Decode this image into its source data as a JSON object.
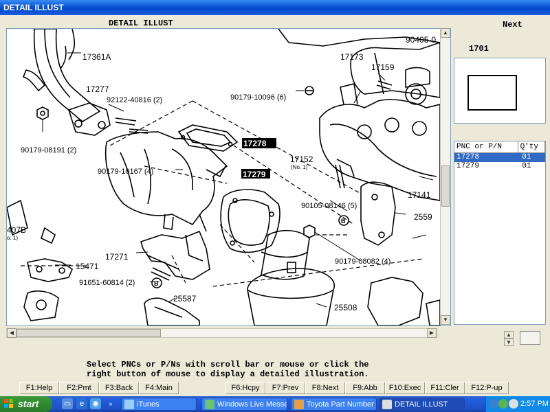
{
  "window": {
    "title": "DETAIL ILLUST"
  },
  "panel": {
    "caption": "DETAIL ILLUST",
    "next_label": "Next",
    "page_number": "1701"
  },
  "illustration": {
    "labels": [
      {
        "text": "90405-0",
        "boxed": false
      },
      {
        "text": "17361A",
        "boxed": false
      },
      {
        "text": "17173",
        "boxed": false
      },
      {
        "text": "17159",
        "boxed": false
      },
      {
        "text": "17277",
        "boxed": false
      },
      {
        "text": "92122-40816 (2)",
        "boxed": false
      },
      {
        "text": "90179-10096 (6)",
        "boxed": false
      },
      {
        "text": "90179-08191 (2)",
        "boxed": false
      },
      {
        "text": "17278",
        "boxed": true
      },
      {
        "text": "17152",
        "boxed": false
      },
      {
        "text": "(No. 1)",
        "boxed": false
      },
      {
        "text": "90179-10167 (4)",
        "boxed": false
      },
      {
        "text": "17279",
        "boxed": true
      },
      {
        "text": "17141",
        "boxed": false
      },
      {
        "text": "90105-08146 (5)",
        "boxed": false
      },
      {
        "text": "2559",
        "boxed": false
      },
      {
        "text": "407B",
        "boxed": false
      },
      {
        "text": "o. 1)",
        "boxed": false
      },
      {
        "text": "17271",
        "boxed": false
      },
      {
        "text": "90179-08082 (4)",
        "boxed": false
      },
      {
        "text": "15471",
        "boxed": false
      },
      {
        "text": "91651-60814 (2)",
        "boxed": false
      },
      {
        "text": "25587",
        "boxed": false
      },
      {
        "text": "25508",
        "boxed": false
      },
      {
        "text": "B",
        "boxed": false
      },
      {
        "text": "B",
        "boxed": false
      }
    ]
  },
  "parts_list": {
    "headers": [
      "PNC or P/N",
      "Q'ty"
    ],
    "rows": [
      {
        "pnc": "17278",
        "qty": "01",
        "selected": true
      },
      {
        "pnc": "17279",
        "qty": "01",
        "selected": false
      }
    ]
  },
  "instructions": {
    "line1": "Select PNCs or P/Ns with scroll bar or mouse or click the",
    "line2": "right button of mouse to display a detailed illustration."
  },
  "function_keys": [
    {
      "label": "F1:Help"
    },
    {
      "label": "F2:Pmt"
    },
    {
      "label": "F3:Back"
    },
    {
      "label": "F4:Main"
    },
    {
      "label": "F6:Hcpy"
    },
    {
      "label": "F7:Prev"
    },
    {
      "label": "F8:Next"
    },
    {
      "label": "F9:Abb"
    },
    {
      "label": "F10:Exec"
    },
    {
      "label": "F11:Cler"
    },
    {
      "label": "F12:P-up"
    }
  ],
  "taskbar": {
    "start_label": "start",
    "tasks": [
      {
        "label": "iTunes",
        "active": false
      },
      {
        "label": "Windows Live Messen...",
        "active": false
      },
      {
        "label": "Toyota Part Number ...",
        "active": false
      },
      {
        "label": "DETAIL ILLUST",
        "active": true
      }
    ],
    "clock": "2:57 PM"
  },
  "colors": {
    "selection": "#316ac5",
    "titlebar": "#0a54d8",
    "taskbar": "#245edb"
  }
}
